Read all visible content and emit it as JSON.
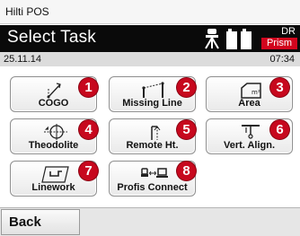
{
  "window": {
    "title": "Hilti POS"
  },
  "header": {
    "title": "Select Task",
    "status_top": "DR",
    "status_mode": "Prism",
    "icons": [
      "tripod-icon",
      "battery-icon"
    ]
  },
  "infobar": {
    "date": "25.11.14",
    "time": "07:34"
  },
  "tasks": [
    {
      "label": "COGO",
      "number": "1",
      "icon": "cogo-icon"
    },
    {
      "label": "Missing Line",
      "number": "2",
      "icon": "missing-line-icon"
    },
    {
      "label": "Area",
      "number": "3",
      "icon": "area-icon"
    },
    {
      "label": "Theodolite",
      "number": "4",
      "icon": "theodolite-icon"
    },
    {
      "label": "Remote Ht.",
      "number": "5",
      "icon": "remote-height-icon"
    },
    {
      "label": "Vert. Align.",
      "number": "6",
      "icon": "vertical-alignment-icon"
    },
    {
      "label": "Linework",
      "number": "7",
      "icon": "linework-icon"
    },
    {
      "label": "Profis Connect",
      "number": "8",
      "icon": "profis-connect-icon"
    }
  ],
  "footer": {
    "back_label": "Back"
  },
  "colors": {
    "badge": "#c7081e",
    "header_bg": "#0a0a0a",
    "prism_bg": "#d2051e"
  }
}
